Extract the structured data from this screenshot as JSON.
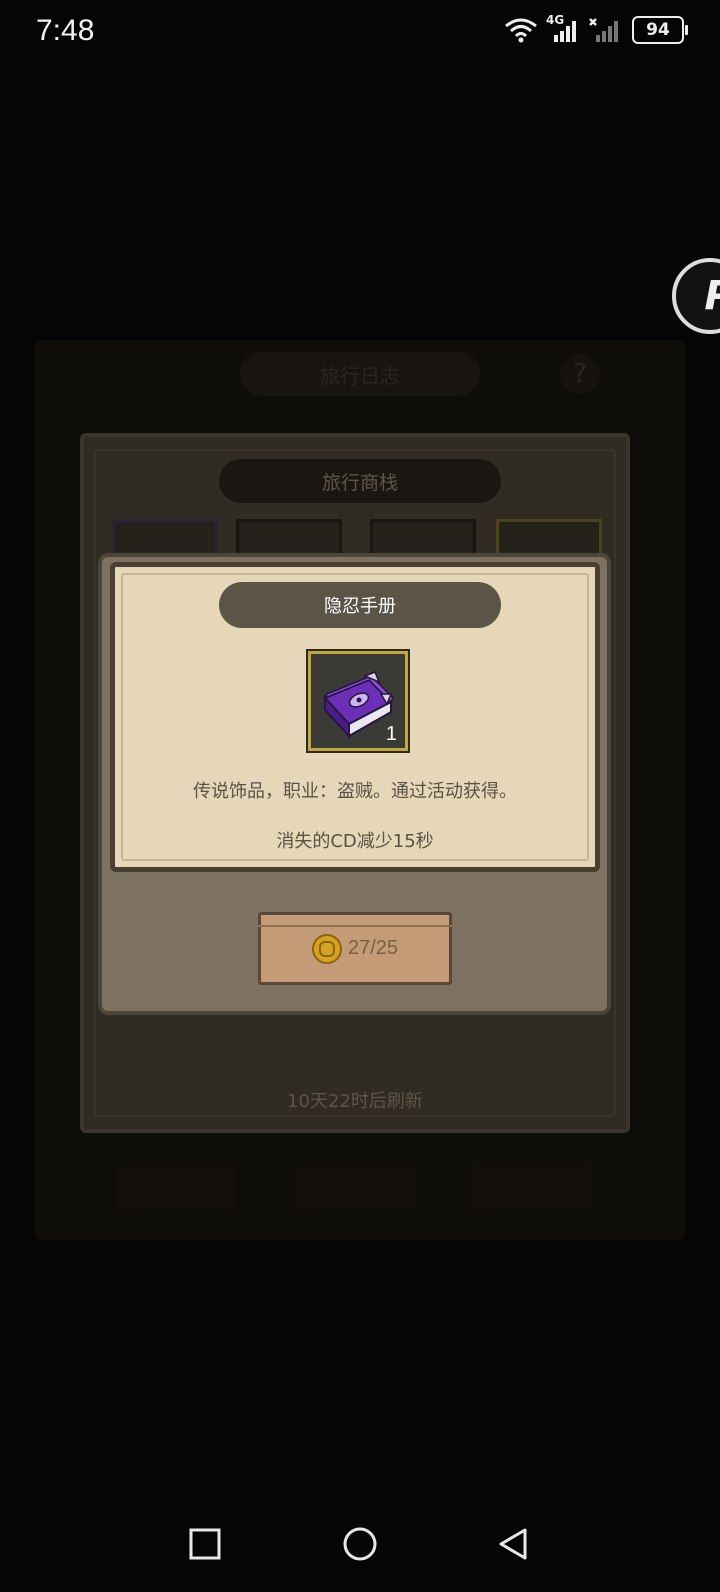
{
  "status_bar": {
    "time": "7:48",
    "network_label": "4G",
    "battery": "94"
  },
  "background": {
    "journal_title": "旅行日志",
    "help_symbol": "?"
  },
  "shop": {
    "title": "旅行商栈",
    "refresh_text": "10天22时后刷新"
  },
  "popup": {
    "title": "隐忍手册",
    "item": {
      "icon": "purple-book-icon",
      "count": "1",
      "description": "传说饰品，职业：盗贼。通过活动获得。",
      "effect": "消失的CD减少15秒"
    },
    "buy_button": {
      "currency_icon": "gold-coin-icon",
      "price": "27/25"
    }
  },
  "nav_bar": {
    "items": [
      "recent-apps",
      "home",
      "back"
    ]
  }
}
